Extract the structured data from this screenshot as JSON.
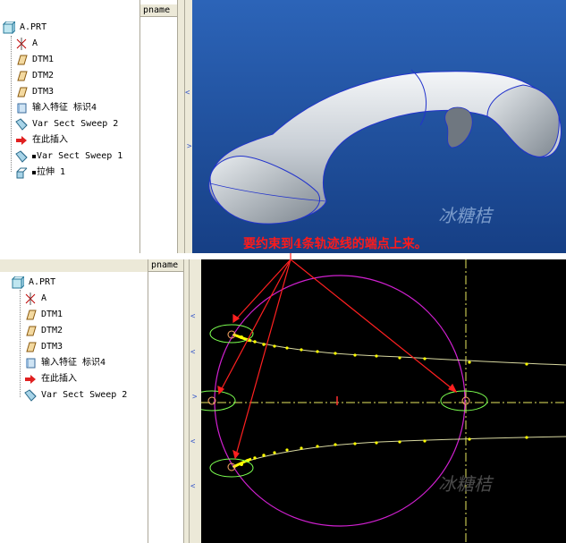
{
  "top_panel": {
    "column_header": "pname",
    "tree": [
      {
        "label": "A.PRT",
        "icon": "part-icon"
      },
      {
        "label": "A",
        "icon": "csys-icon"
      },
      {
        "label": "DTM1",
        "icon": "datum-plane-icon"
      },
      {
        "label": "DTM2",
        "icon": "datum-plane-icon"
      },
      {
        "label": "DTM3",
        "icon": "datum-plane-icon"
      },
      {
        "label": "输入特征 标识4",
        "icon": "import-feature-icon"
      },
      {
        "label": "Var Sect Sweep 2",
        "icon": "sweep-icon"
      },
      {
        "label": "在此插入",
        "icon": "insert-here-arrow-icon"
      },
      {
        "label": "Var Sect Sweep 1",
        "icon": "sweep-icon"
      },
      {
        "label": "拉伸 1",
        "icon": "extrude-icon"
      }
    ],
    "watermark": "冰糖桔"
  },
  "bottom_panel": {
    "column_header": "pname",
    "tree": [
      {
        "label": "A.PRT",
        "icon": "part-icon"
      },
      {
        "label": "A",
        "icon": "csys-icon"
      },
      {
        "label": "DTM1",
        "icon": "datum-plane-icon"
      },
      {
        "label": "DTM2",
        "icon": "datum-plane-icon"
      },
      {
        "label": "DTM3",
        "icon": "datum-plane-icon"
      },
      {
        "label": "输入特征 标识4",
        "icon": "import-feature-icon"
      },
      {
        "label": "在此插入",
        "icon": "insert-here-arrow-icon"
      },
      {
        "label": "Var Sect Sweep 2",
        "icon": "sweep-icon"
      }
    ],
    "watermark": "冰糖桔"
  },
  "annotation": "要约束到4条轨迹线的端点上来。",
  "colors": {
    "viewport_top_bg": "#1d4f9e",
    "sketch_bg": "#000000",
    "trajectory": "#ffff00",
    "circle": "#d020d0",
    "highlight_ellipse": "#7cff50",
    "annotation_red": "#ff1a1a"
  }
}
